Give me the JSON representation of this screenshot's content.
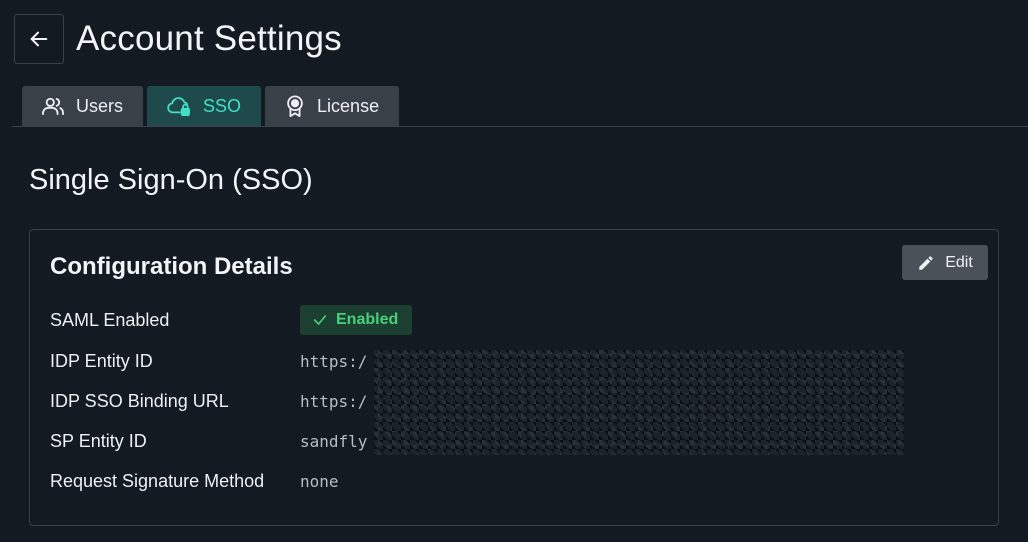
{
  "header": {
    "title": "Account Settings",
    "back_icon": "arrow-left-icon"
  },
  "tabs": [
    {
      "label": "Users",
      "icon": "users-icon",
      "active": false
    },
    {
      "label": "SSO",
      "icon": "cloud-lock-icon",
      "active": true
    },
    {
      "label": "License",
      "icon": "award-badge-icon",
      "active": false
    }
  ],
  "section": {
    "title": "Single Sign-On (SSO)"
  },
  "card": {
    "title": "Configuration Details",
    "edit_label": "Edit",
    "rows": [
      {
        "label": "SAML Enabled",
        "value": "Enabled",
        "type": "badge"
      },
      {
        "label": "IDP Entity ID",
        "value": "https:/",
        "type": "text"
      },
      {
        "label": "IDP SSO Binding URL",
        "value": "https:/",
        "type": "text"
      },
      {
        "label": "SP Entity ID",
        "value": "sandfly",
        "type": "text"
      },
      {
        "label": "Request Signature Method",
        "value": "none",
        "type": "text"
      }
    ]
  },
  "colors": {
    "background": "#141a22",
    "accent": "#3fe0c7",
    "enabled_green": "#4ad07a"
  }
}
